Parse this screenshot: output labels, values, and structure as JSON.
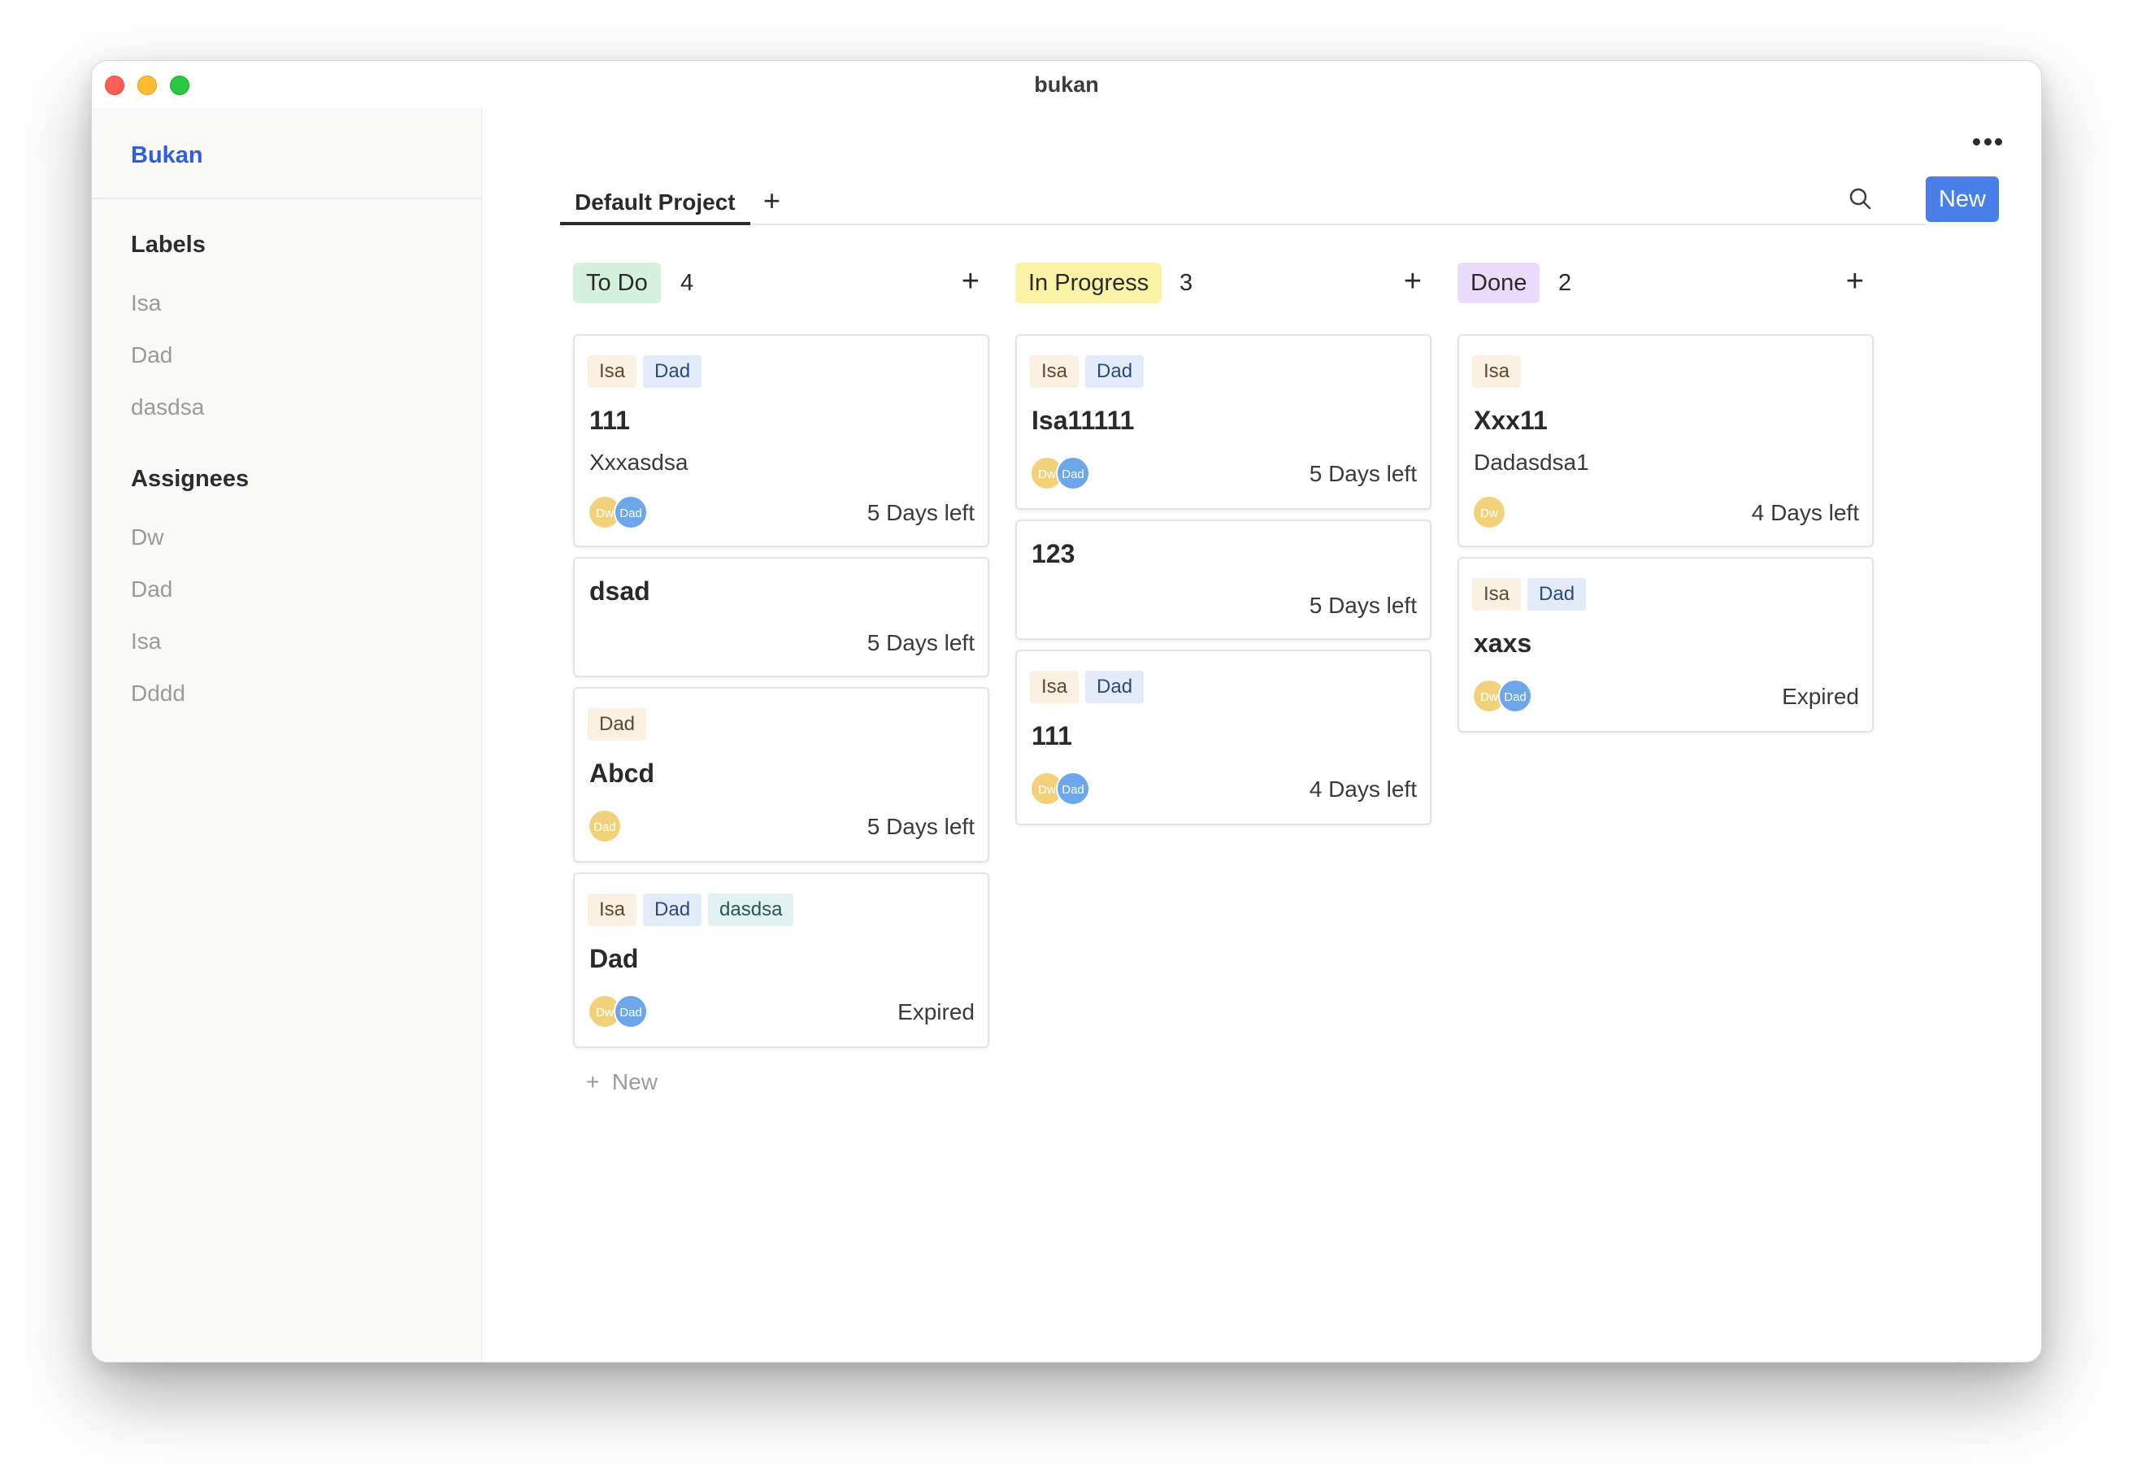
{
  "window": {
    "title": "bukan"
  },
  "sidebar": {
    "brand": "Bukan",
    "labels_heading": "Labels",
    "labels": [
      "Isa",
      "Dad",
      "dasdsa"
    ],
    "assignees_heading": "Assignees",
    "assignees": [
      "Dw",
      "Dad",
      "Isa",
      "Dddd"
    ]
  },
  "header": {
    "tab": "Default Project",
    "tab_add": "+",
    "new_button": "New"
  },
  "columns": [
    {
      "name": "To Do",
      "count": "4",
      "add": "+",
      "color": "#d3f1dc",
      "cards": [
        {
          "tags": [
            "Isa",
            "Dad"
          ],
          "title": "111",
          "desc": "Xxxasdsa",
          "avatars": [
            "Dw",
            "Dad"
          ],
          "due": "5 Days left"
        },
        {
          "tags": [],
          "title": "dsad",
          "desc": "",
          "avatars": [],
          "due": "5 Days left"
        },
        {
          "tags": [
            "Dad"
          ],
          "title": "Abcd",
          "desc": "",
          "avatars": [
            "Dad"
          ],
          "due": "5 Days left"
        },
        {
          "tags": [
            "Isa",
            "Dad",
            "dasdsa"
          ],
          "title": "Dad",
          "desc": "",
          "avatars": [
            "Dw",
            "Dad"
          ],
          "due": "Expired"
        }
      ],
      "add_new": "New"
    },
    {
      "name": "In Progress",
      "count": "3",
      "add": "+",
      "color": "#fbf3a6",
      "cards": [
        {
          "tags": [
            "Isa",
            "Dad"
          ],
          "title": "Isa11111",
          "desc": "",
          "avatars": [
            "Dw",
            "Dad"
          ],
          "due": "5 Days left"
        },
        {
          "tags": [],
          "title": "123",
          "desc": "",
          "avatars": [],
          "due": "5 Days left"
        },
        {
          "tags": [
            "Isa",
            "Dad"
          ],
          "title": "111",
          "desc": "",
          "avatars": [
            "Dw",
            "Dad"
          ],
          "due": "4 Days left"
        }
      ]
    },
    {
      "name": "Done",
      "count": "2",
      "add": "+",
      "color": "#e9dcfa",
      "cards": [
        {
          "tags": [
            "Isa"
          ],
          "title": "Xxx11",
          "desc": "Dadasdsa1",
          "avatars": [
            "Dw"
          ],
          "due": "4 Days left"
        },
        {
          "tags": [
            "Isa",
            "Dad"
          ],
          "title": "xaxs",
          "desc": "",
          "avatars": [
            "Dw",
            "Dad"
          ],
          "due": "Expired"
        }
      ]
    }
  ]
}
